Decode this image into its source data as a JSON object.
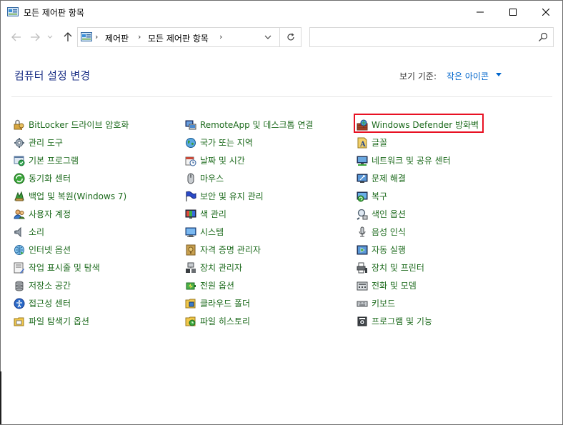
{
  "window": {
    "title": "모든 제어판 항목"
  },
  "navigation": {
    "breadcrumb": [
      "제어판",
      "모든 제어판 항목"
    ],
    "search_placeholder": ""
  },
  "header": {
    "page_title": "컴퓨터 설정 변경",
    "view_by_label": "보기 기준:",
    "view_by_value": "작은 아이콘"
  },
  "items": {
    "col1": [
      {
        "label": "BitLocker 드라이브 암호화",
        "icon": "bitlocker-icon"
      },
      {
        "label": "관리 도구",
        "icon": "admin-tools-icon"
      },
      {
        "label": "기본 프로그램",
        "icon": "default-programs-icon"
      },
      {
        "label": "동기화 센터",
        "icon": "sync-center-icon"
      },
      {
        "label": "백업 및 복원(Windows 7)",
        "icon": "backup-restore-icon"
      },
      {
        "label": "사용자 계정",
        "icon": "user-accounts-icon"
      },
      {
        "label": "소리",
        "icon": "sound-icon"
      },
      {
        "label": "인터넷 옵션",
        "icon": "internet-options-icon"
      },
      {
        "label": "작업 표시줄 및 탐색",
        "icon": "taskbar-icon"
      },
      {
        "label": "저장소 공간",
        "icon": "storage-spaces-icon"
      },
      {
        "label": "접근성 센터",
        "icon": "ease-of-access-icon"
      },
      {
        "label": "파일 탐색기 옵션",
        "icon": "file-explorer-options-icon"
      }
    ],
    "col2": [
      {
        "label": "RemoteApp 및 데스크톱 연결",
        "icon": "remoteapp-icon"
      },
      {
        "label": "국가 또는 지역",
        "icon": "region-icon"
      },
      {
        "label": "날짜 및 시간",
        "icon": "date-time-icon"
      },
      {
        "label": "마우스",
        "icon": "mouse-icon"
      },
      {
        "label": "보안 및 유지 관리",
        "icon": "security-maintenance-icon"
      },
      {
        "label": "색 관리",
        "icon": "color-management-icon"
      },
      {
        "label": "시스템",
        "icon": "system-icon"
      },
      {
        "label": "자격 증명 관리자",
        "icon": "credential-manager-icon"
      },
      {
        "label": "장치 관리자",
        "icon": "device-manager-icon"
      },
      {
        "label": "전원 옵션",
        "icon": "power-options-icon"
      },
      {
        "label": "클라우드 폴더",
        "icon": "work-folders-icon"
      },
      {
        "label": "파일 히스토리",
        "icon": "file-history-icon"
      }
    ],
    "col3": [
      {
        "label": "Windows Defender 방화벽",
        "icon": "firewall-icon"
      },
      {
        "label": "글꼴",
        "icon": "fonts-icon"
      },
      {
        "label": "네트워크 및 공유 센터",
        "icon": "network-sharing-icon"
      },
      {
        "label": "문제 해결",
        "icon": "troubleshooting-icon"
      },
      {
        "label": "복구",
        "icon": "recovery-icon"
      },
      {
        "label": "색인 옵션",
        "icon": "indexing-options-icon"
      },
      {
        "label": "음성 인식",
        "icon": "speech-recognition-icon"
      },
      {
        "label": "자동 실행",
        "icon": "autoplay-icon"
      },
      {
        "label": "장치 및 프린터",
        "icon": "devices-printers-icon"
      },
      {
        "label": "전화 및 모뎀",
        "icon": "phone-modem-icon"
      },
      {
        "label": "키보드",
        "icon": "keyboard-icon"
      },
      {
        "label": "프로그램 및 기능",
        "icon": "programs-features-icon"
      }
    ]
  },
  "colors": {
    "link": "#1c6a1c",
    "title": "#1e3287",
    "accent": "#0066cc",
    "highlight": "#e81123"
  }
}
